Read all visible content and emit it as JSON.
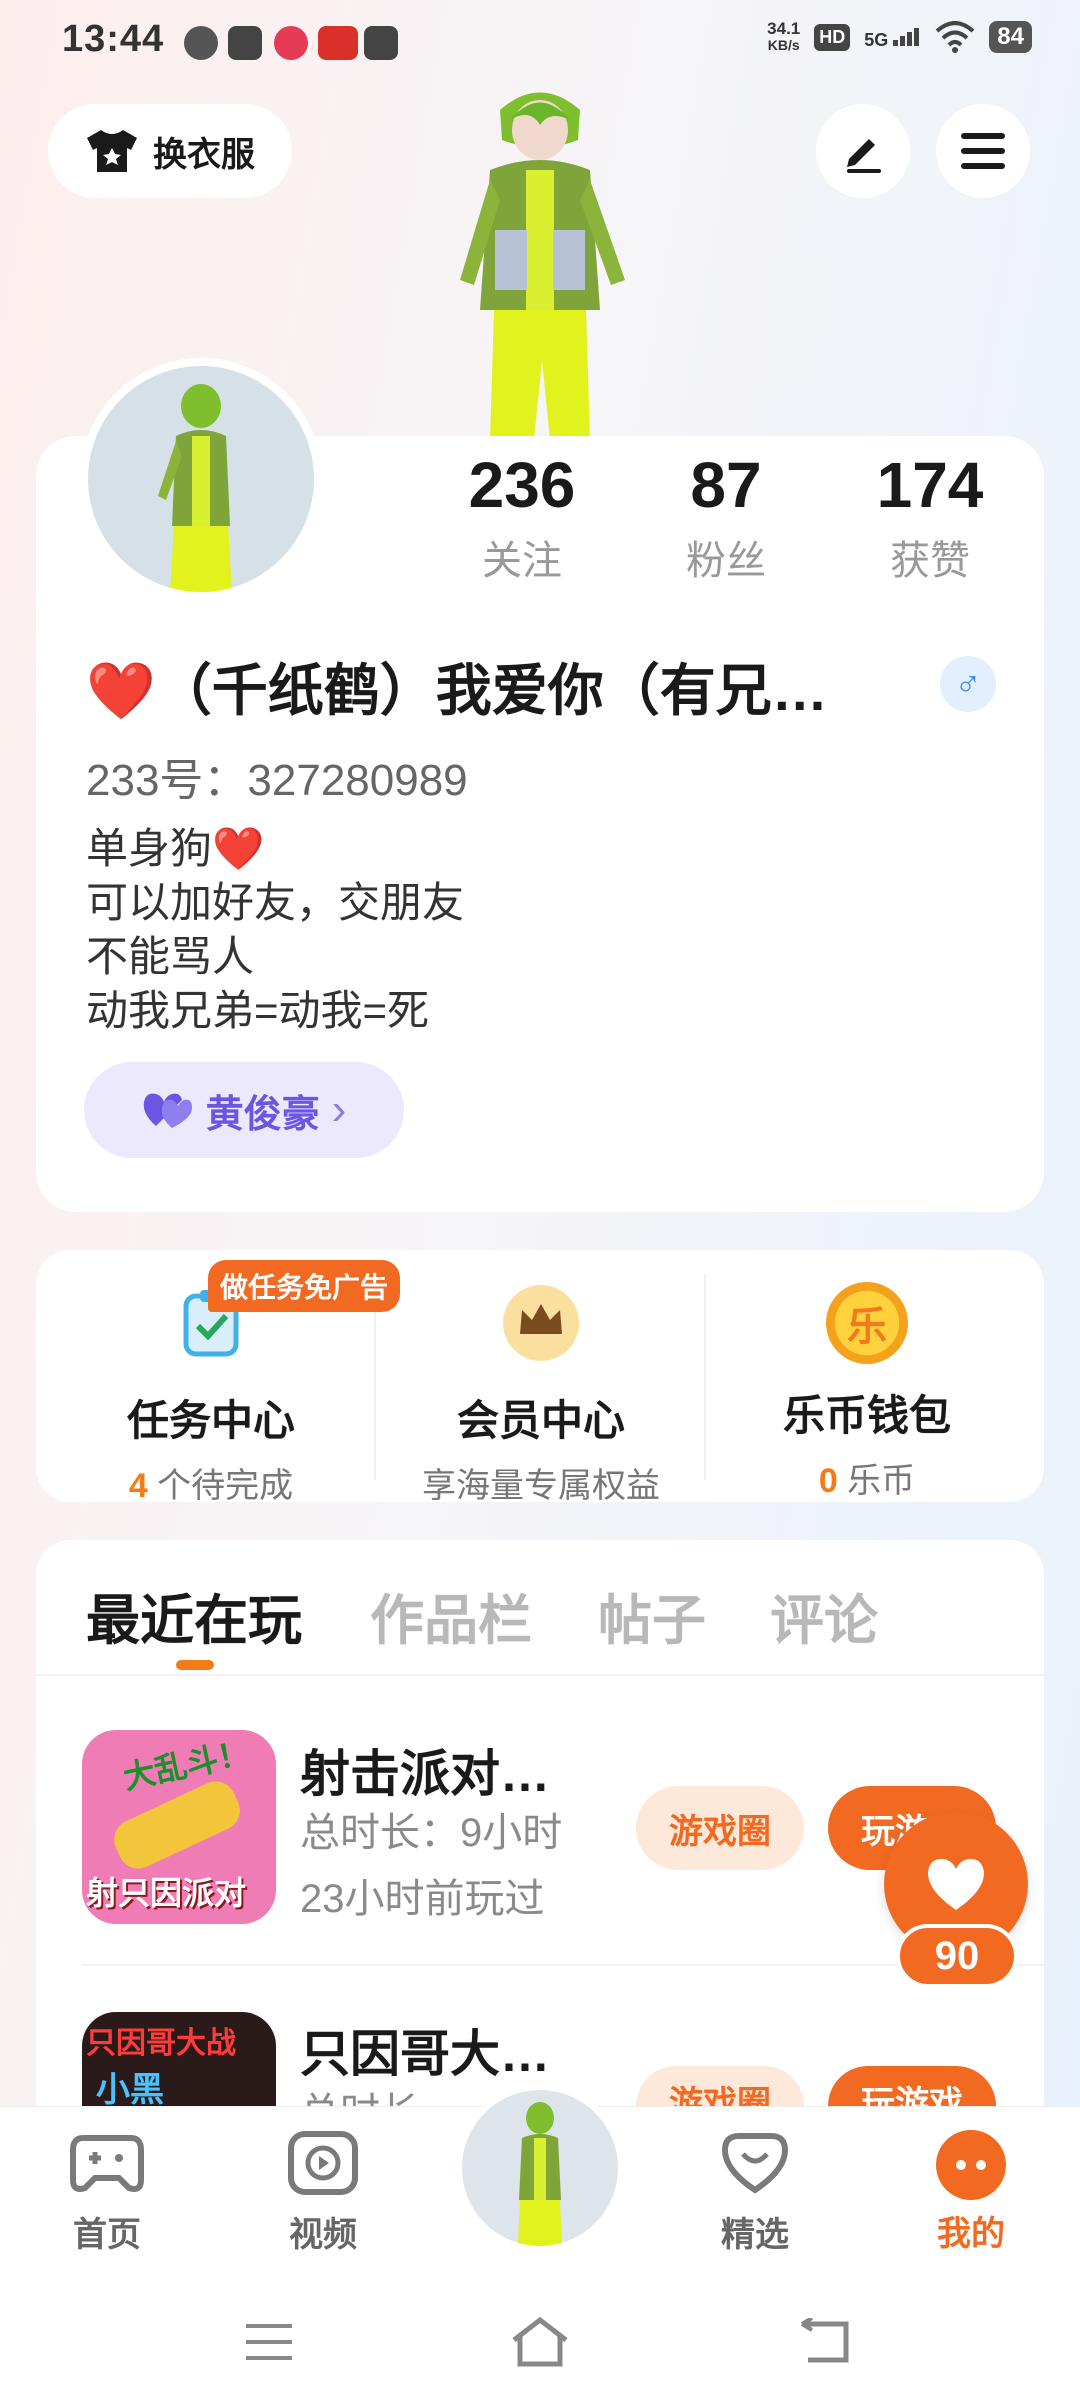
{
  "status_bar": {
    "time": "13:44",
    "net_speed_value": "34.1",
    "net_speed_unit": "KB/s",
    "hd": "HD",
    "network": "5G",
    "battery": "84"
  },
  "top_actions": {
    "outfit_label": "换衣服"
  },
  "profile": {
    "stats": [
      {
        "value": "236",
        "label": "关注"
      },
      {
        "value": "87",
        "label": "粉丝"
      },
      {
        "value": "174",
        "label": "获赞"
      }
    ],
    "nickname": "❤️（千纸鹤）我爱你（有兄…",
    "gender_symbol": "♂",
    "id_text": "233号：327280989",
    "bio": [
      "单身狗❤️",
      "可以加好友，交朋友",
      "不能骂人",
      "动我兄弟=动我=死"
    ],
    "tag_label": "黄俊豪",
    "tag_chevron": "›"
  },
  "services": {
    "badge": "做任务免广告",
    "items": [
      {
        "title": "任务中心",
        "count": "4",
        "sub": " 个待完成"
      },
      {
        "title": "会员中心",
        "count": "",
        "sub": "享海量专属权益"
      },
      {
        "title": "乐币钱包",
        "count": "0",
        "sub": " 乐币"
      }
    ],
    "coin_glyph": "乐"
  },
  "tabs": [
    "最近在玩",
    "作品栏",
    "帖子",
    "评论"
  ],
  "games": [
    {
      "title": "射击派对…",
      "duration": "总时长：9小时",
      "last_played": "23小时前玩过",
      "circle_label": "游戏圈",
      "play_label": "玩游戏",
      "icon_text_top": "大乱斗！",
      "icon_text_bottom": "射只因派对"
    },
    {
      "title": "只因哥大…",
      "duration": "总时长",
      "circle_label": "游戏圈",
      "play_label": "玩游戏",
      "icon_text_top": "只因哥大战",
      "icon_text_bottom": "小黑"
    }
  ],
  "like_count": "90",
  "nav": [
    {
      "label": "首页",
      "icon": "gamepad-icon"
    },
    {
      "label": "视频",
      "icon": "play-icon"
    },
    {
      "label": "精选",
      "icon": "heart-chat-icon"
    },
    {
      "label": "我的",
      "icon": "dots-icon"
    }
  ],
  "colors": {
    "accent": "#f26a21",
    "tag_purple": "#6b56e4",
    "gender_blue": "#3b8beb"
  }
}
